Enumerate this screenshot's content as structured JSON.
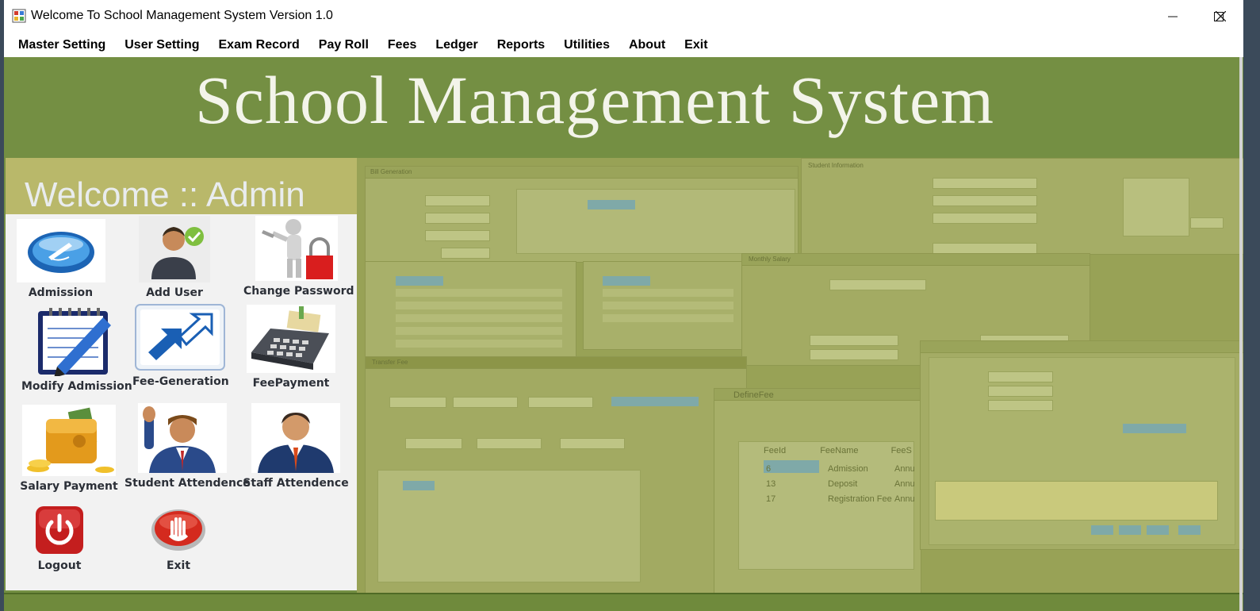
{
  "window": {
    "title": "Welcome To School Management System Version 1.0",
    "controls": {
      "minimize": "—",
      "maximize": "☐",
      "close": "✕"
    }
  },
  "menu": {
    "items": [
      "Master Setting",
      "User Setting",
      "Exam Record",
      "Pay Roll",
      "Fees",
      "Ledger",
      "Reports",
      "Utilities",
      "About",
      "Exit"
    ]
  },
  "banner": {
    "title": "School Management System"
  },
  "welcome": {
    "text": "Welcome :: Admin"
  },
  "tiles": {
    "admission": "Admission",
    "add_user": "Add User",
    "change_password": "Change Password",
    "modify_admission": "Modify Admission",
    "fee_generation": "Fee-Generation",
    "fee_payment": "FeePayment",
    "salary_payment": "Salary Payment",
    "student_attendence": "Student Attendence",
    "staff_attendence": "Staff Attendence",
    "logout": "Logout",
    "exit": "Exit"
  },
  "background_windows": {
    "bill_generation": "Bill Generation",
    "transfer_fee": "Transfer Fee",
    "define_fee": "DefineFee",
    "student_information": "Student Information",
    "monthly_salary": "Monthly Salary",
    "fee_grid_headers": [
      "FeeId",
      "FeeName",
      "FeeS"
    ],
    "fee_grid_rows": [
      [
        "6",
        "Admission",
        "Annu"
      ],
      [
        "13",
        "Deposit",
        "Annu"
      ],
      [
        "17",
        "Registration Fee",
        "Annu"
      ]
    ]
  },
  "colors": {
    "banner_green": "#748f43",
    "welcome_khaki": "#b9b86a",
    "panel_gray": "#f2f2f2"
  }
}
